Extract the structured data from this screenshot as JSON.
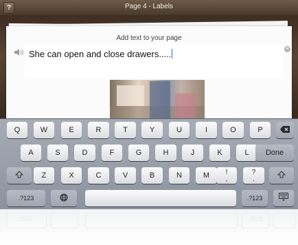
{
  "titlebar": {
    "help_label": "?",
    "title": "Page 4 - Labels"
  },
  "editor": {
    "prompt": "Add text to your page",
    "text_value": "She can open and close drawers.....",
    "clear_icon": "clear-icon",
    "speaker_icon": "speaker-icon"
  },
  "keyboard": {
    "row1": [
      "Q",
      "W",
      "E",
      "R",
      "T",
      "Y",
      "U",
      "I",
      "O",
      "P"
    ],
    "row2": [
      "A",
      "S",
      "D",
      "F",
      "G",
      "H",
      "J",
      "K",
      "L"
    ],
    "row3": [
      "Z",
      "X",
      "C",
      "V",
      "B",
      "N",
      "M"
    ],
    "row3_punct1": [
      "!",
      ","
    ],
    "row3_punct2": [
      "?",
      "."
    ],
    "done_label": "Done",
    "numbers_label": ".?123",
    "backspace_icon": "backspace-icon",
    "shift_icon": "shift-icon",
    "globe_icon": "globe-icon",
    "hide_keyboard_icon": "hide-keyboard-icon"
  },
  "reflection": {
    "left_label": ".?123",
    "right_label": ".?123"
  }
}
